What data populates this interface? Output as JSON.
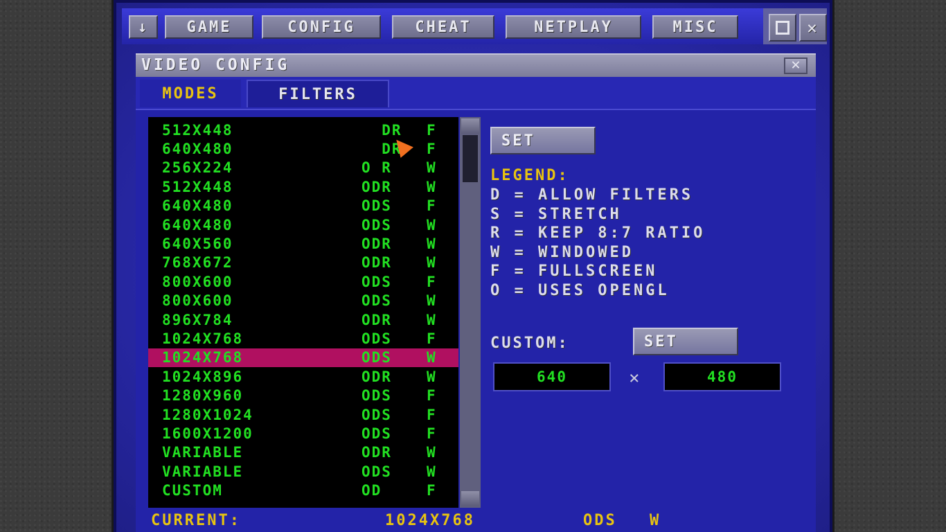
{
  "menu": {
    "down_icon": "down-arrow-icon",
    "items": [
      {
        "label": "GAME"
      },
      {
        "label": "CONFIG"
      },
      {
        "label": "CHEAT"
      },
      {
        "label": "NETPLAY"
      },
      {
        "label": "MISC"
      }
    ],
    "maximize_icon": "maximize-icon",
    "close_icon": "close-icon"
  },
  "dialog": {
    "title": "VIDEO CONFIG",
    "close_glyph": "✕",
    "tabs": [
      {
        "label": "MODES",
        "active": true
      },
      {
        "label": "FILTERS",
        "active": false
      }
    ]
  },
  "modes": [
    {
      "res": "512X448",
      "flags": "  DR",
      "mode": "F"
    },
    {
      "res": "640X480",
      "flags": "  DR",
      "mode": "F"
    },
    {
      "res": "256X224",
      "flags": "O R",
      "mode": "W"
    },
    {
      "res": "512X448",
      "flags": "ODR",
      "mode": "W"
    },
    {
      "res": "640X480",
      "flags": "ODS",
      "mode": "F"
    },
    {
      "res": "640X480",
      "flags": "ODS",
      "mode": "W"
    },
    {
      "res": "640X560",
      "flags": "ODR",
      "mode": "W"
    },
    {
      "res": "768X672",
      "flags": "ODR",
      "mode": "W"
    },
    {
      "res": "800X600",
      "flags": "ODS",
      "mode": "F"
    },
    {
      "res": "800X600",
      "flags": "ODS",
      "mode": "W"
    },
    {
      "res": "896X784",
      "flags": "ODR",
      "mode": "W"
    },
    {
      "res": "1024X768",
      "flags": "ODS",
      "mode": "F"
    },
    {
      "res": "1024X768",
      "flags": "ODS",
      "mode": "W",
      "selected": true
    },
    {
      "res": "1024X896",
      "flags": "ODR",
      "mode": "W"
    },
    {
      "res": "1280X960",
      "flags": "ODS",
      "mode": "F"
    },
    {
      "res": "1280X1024",
      "flags": "ODS",
      "mode": "F"
    },
    {
      "res": "1600X1200",
      "flags": "ODS",
      "mode": "F"
    },
    {
      "res": "VARIABLE",
      "flags": "ODR",
      "mode": "W"
    },
    {
      "res": "VARIABLE",
      "flags": "ODS",
      "mode": "W"
    },
    {
      "res": "CUSTOM",
      "flags": "OD",
      "mode": "F"
    }
  ],
  "set_label": "SET",
  "legend": {
    "title": "LEGEND:",
    "items": [
      "D = ALLOW FILTERS",
      "S = STRETCH",
      "R = KEEP 8:7 RATIO",
      "W = WINDOWED",
      "F = FULLSCREEN",
      "O = USES OPENGL"
    ]
  },
  "custom": {
    "label": "CUSTOM:",
    "set_label": "SET",
    "width": "640",
    "height": "480",
    "times": "×"
  },
  "status": {
    "label": "CURRENT:",
    "res": "1024X768",
    "flags": "ODS",
    "mode": "W"
  },
  "colors": {
    "list_text": "#22e022",
    "selection": "#b01060",
    "accent": "#e8c410",
    "panel": "#2323a8"
  }
}
